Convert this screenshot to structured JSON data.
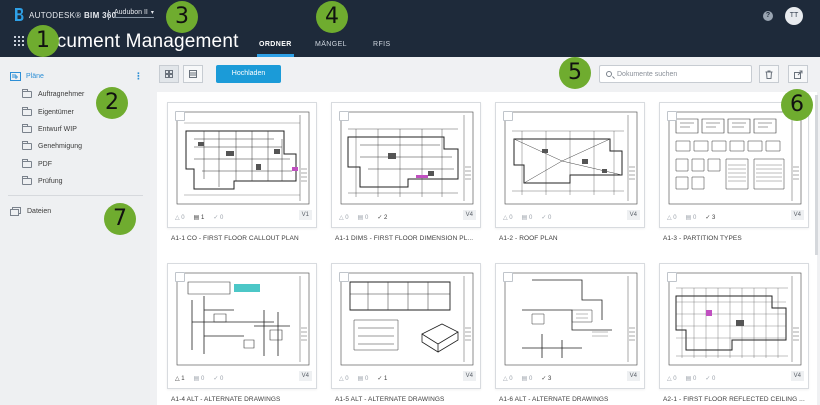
{
  "header": {
    "brand_name": "AUTODESK",
    "product_name": "BIM 360",
    "project_name": "Audubon II",
    "page_title": "Document Management",
    "tabs": [
      {
        "label": "ORDNER",
        "active": true
      },
      {
        "label": "MÄNGEL",
        "active": false
      },
      {
        "label": "RFIS",
        "active": false
      }
    ],
    "help_label": "?",
    "avatar_initials": "TT"
  },
  "sidebar": {
    "section_label": "Pläne",
    "folders": [
      "Auftragnehmer",
      "Eigentümer",
      "Entwurf WIP",
      "Genehmigung",
      "PDF",
      "Prüfung"
    ],
    "files_label": "Dateien"
  },
  "toolbar": {
    "upload_label": "Hochladen",
    "search_placeholder": "Dokumente suchen"
  },
  "documents": [
    {
      "name": "A1-1 CO - FIRST FLOOR CALLOUT PLAN",
      "issues": "0",
      "markups": "1",
      "reviews": "0",
      "version": "V1"
    },
    {
      "name": "A1-1 DIMS - FIRST FLOOR DIMENSION PL...",
      "issues": "0",
      "markups": "0",
      "reviews": "2",
      "version": "V4"
    },
    {
      "name": "A1-2 - ROOF PLAN",
      "issues": "0",
      "markups": "0",
      "reviews": "0",
      "version": "V4"
    },
    {
      "name": "A1-3 - PARTITION TYPES",
      "issues": "0",
      "markups": "0",
      "reviews": "3",
      "version": "V4"
    },
    {
      "name": "A1-4 ALT - ALTERNATE DRAWINGS",
      "issues": "1",
      "markups": "0",
      "reviews": "0",
      "version": "V4"
    },
    {
      "name": "A1-5 ALT - ALTERNATE DRAWINGS",
      "issues": "0",
      "markups": "0",
      "reviews": "1",
      "version": "V4"
    },
    {
      "name": "A1-6 ALT - ALTERNATE DRAWINGS",
      "issues": "0",
      "markups": "0",
      "reviews": "3",
      "version": "V4"
    },
    {
      "name": "A2-1 - FIRST FLOOR REFLECTED CEILING ...",
      "issues": "0",
      "markups": "0",
      "reviews": "0",
      "version": "V4"
    }
  ],
  "annotations": [
    "1",
    "2",
    "3",
    "4",
    "5",
    "6",
    "7"
  ],
  "colors": {
    "header_bg": "#1e2a3a",
    "accent_blue": "#1b9bd8",
    "badge_green": "#6fac2f",
    "sidebar_bg": "#eef0f2"
  }
}
